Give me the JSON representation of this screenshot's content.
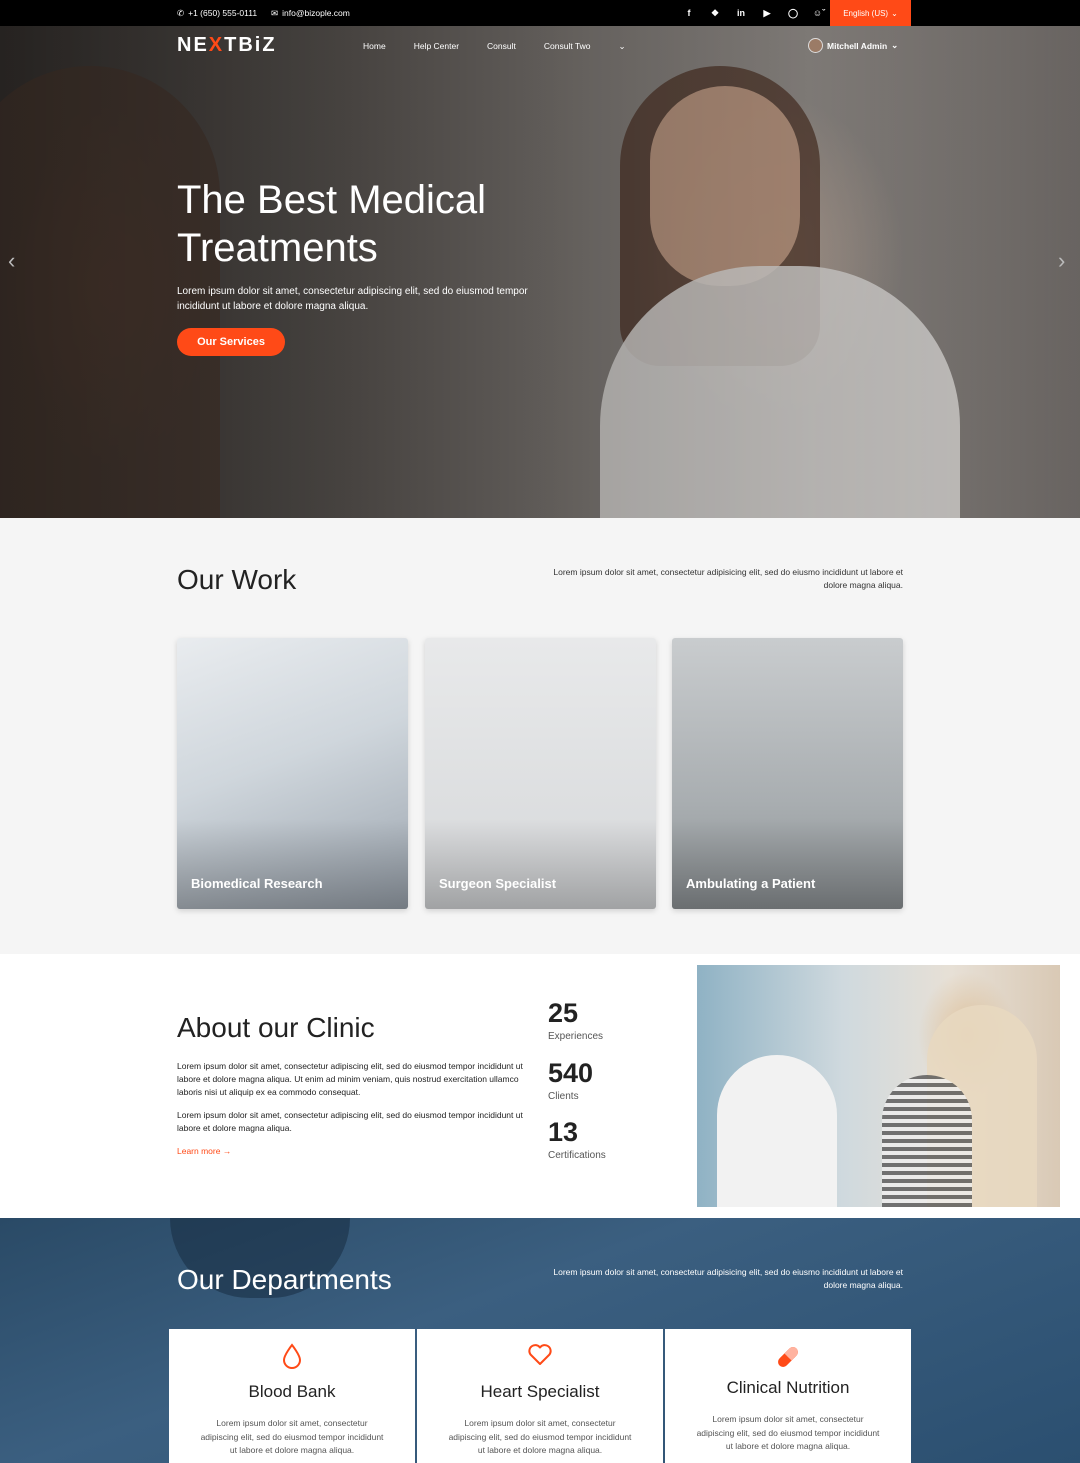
{
  "topbar": {
    "phone": "+1 (650) 555-0111",
    "email": "info@bizople.com",
    "socials": [
      "f",
      "t",
      "in",
      "yt",
      "ig"
    ],
    "language": "English (US)",
    "colors": {
      "bar": "#000000",
      "accent": "#ff4a17"
    }
  },
  "nav": {
    "logo_pre": "NE",
    "logo_x": "X",
    "logo_post": "TBiZ",
    "items": [
      "Home",
      "Help Center",
      "Consult",
      "Consult Two"
    ],
    "user": "Mitchell Admin"
  },
  "hero": {
    "title": "The Best Medical Treatments",
    "subtitle": "Lorem ipsum dolor sit amet, consectetur adipiscing elit, sed do eiusmod tempor incididunt ut labore et dolore magna aliqua.",
    "button": "Our Services"
  },
  "work": {
    "title": "Our Work",
    "intro": "Lorem ipsum dolor sit amet, consectetur adipisicing elit, sed do eiusmo incididunt ut labore et dolore magna aliqua.",
    "cards": [
      "Biomedical Research",
      "Surgeon Specialist",
      "Ambulating a Patient"
    ]
  },
  "about": {
    "title": "About our Clinic",
    "p1": "Lorem ipsum dolor sit amet, consectetur adipiscing elit, sed do eiusmod tempor incididunt ut labore et dolore magna aliqua. Ut enim ad minim veniam, quis nostrud exercitation ullamco laboris nisi ut aliquip ex ea commodo consequat.",
    "p2": "Lorem ipsum dolor sit amet, consectetur adipiscing elit, sed do eiusmod tempor incididunt ut labore et dolore magna aliqua.",
    "more": "Learn more →",
    "stats": [
      {
        "value": "25",
        "label": "Experiences"
      },
      {
        "value": "540",
        "label": "Clients"
      },
      {
        "value": "13",
        "label": "Certifications"
      }
    ]
  },
  "departments": {
    "title": "Our Departments",
    "intro": "Lorem ipsum dolor sit amet, consectetur adipisicing elit, sed do eiusmo incididunt ut labore et dolore magna aliqua.",
    "items": [
      {
        "icon": "blood-drop-icon",
        "title": "Blood Bank",
        "desc": "Lorem ipsum dolor sit amet, consectetur adipiscing elit, sed do eiusmod tempor incididunt ut labore et dolore magna aliqua."
      },
      {
        "icon": "heart-icon",
        "title": "Heart Specialist",
        "desc": "Lorem ipsum dolor sit amet, consectetur adipiscing elit, sed do eiusmod tempor incididunt ut labore et dolore magna aliqua."
      },
      {
        "icon": "pill-icon",
        "title": "Clinical Nutrition",
        "desc": "Lorem ipsum dolor sit amet, consectetur adipiscing elit, sed do eiusmod tempor incididunt ut labore et dolore magna aliqua."
      }
    ]
  }
}
